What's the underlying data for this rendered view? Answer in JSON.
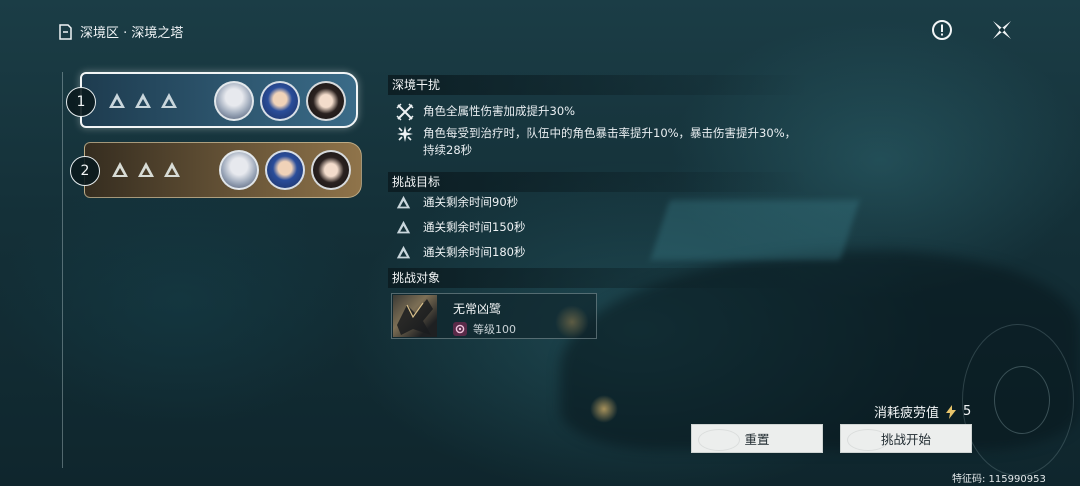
{
  "header": {
    "title": "深境区 · 深境之塔",
    "icon": "tower-icon"
  },
  "top_actions": {
    "info_icon": "info-icon",
    "close_icon": "close-icon"
  },
  "teams": [
    {
      "number": "1",
      "stars": 3,
      "selected": true
    },
    {
      "number": "2",
      "stars": 3,
      "selected": false
    }
  ],
  "disturbance": {
    "title": "深境干扰",
    "items": [
      {
        "icon": "sword-cross-icon",
        "text": "角色全属性伤害加成提升30%"
      },
      {
        "icon": "burst-icon",
        "text": "角色每受到治疗时，队伍中的角色暴击率提升10%，暴击伤害提升30%，持续28秒"
      }
    ]
  },
  "objectives": {
    "title": "挑战目标",
    "items": [
      "通关剩余时间90秒",
      "通关剩余时间150秒",
      "通关剩余时间180秒"
    ]
  },
  "enemies": {
    "title": "挑战对象",
    "items": [
      {
        "name": "无常凶鹭",
        "level": "等级100"
      }
    ]
  },
  "cost": {
    "label": "消耗疲劳值",
    "value": "5"
  },
  "buttons": {
    "reset": "重置",
    "start": "挑战开始"
  },
  "uid": "特征码: 115990953",
  "colors": {
    "accent_gold": "#e7c46b",
    "button_bg": "#eceeed",
    "background": "#143038"
  }
}
